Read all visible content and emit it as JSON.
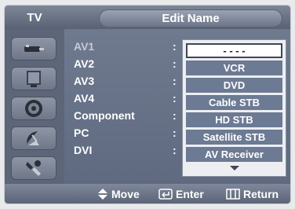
{
  "header": {
    "section_label": "TV",
    "title": "Edit Name"
  },
  "sidebar": {
    "items": [
      {
        "icon": "antenna-input-icon"
      },
      {
        "icon": "tv-picture-icon"
      },
      {
        "icon": "speaker-sound-icon"
      },
      {
        "icon": "satellite-dish-icon"
      },
      {
        "icon": "setup-tools-icon"
      }
    ]
  },
  "sources": [
    {
      "label": "AV1",
      "separator": ":"
    },
    {
      "label": "AV2",
      "separator": ":"
    },
    {
      "label": "AV3",
      "separator": ":"
    },
    {
      "label": "AV4",
      "separator": ":"
    },
    {
      "label": "Component",
      "separator": ":"
    },
    {
      "label": "PC",
      "separator": ":"
    },
    {
      "label": "DVI",
      "separator": ":"
    }
  ],
  "dropdown": {
    "options": [
      "- - - -",
      "VCR",
      "DVD",
      "Cable STB",
      "HD STB",
      "Satellite STB",
      "AV Receiver"
    ],
    "selected_index": 0,
    "more_icon": "arrow-down-icon"
  },
  "footer": {
    "move": {
      "icon": "up-down-arrows-icon",
      "label": "Move"
    },
    "enter": {
      "icon": "enter-icon",
      "label": "Enter"
    },
    "return": {
      "icon": "return-icon",
      "label": "Return"
    }
  },
  "colors": {
    "panel": "#6f7a8f",
    "sidebar": "#5d6678",
    "dropdown_item": "#6c7a93",
    "selected_bg": "#ffffff"
  }
}
